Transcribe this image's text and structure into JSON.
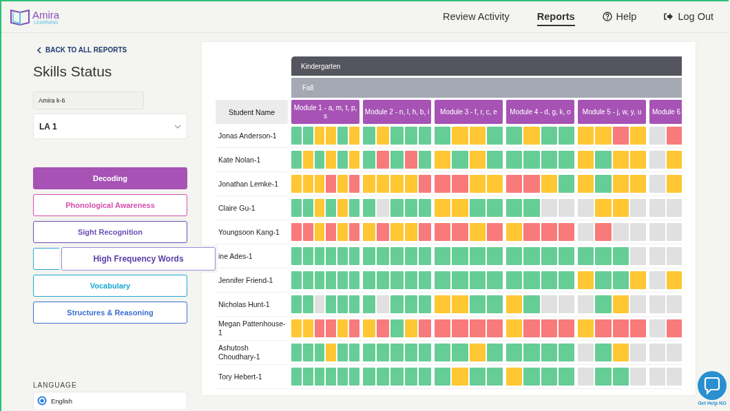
{
  "header": {
    "logo": {
      "name": "Amira",
      "sub": "LEARNING"
    },
    "nav": [
      {
        "label": "Review Activity",
        "kind": "text",
        "selected": false
      },
      {
        "label": "Reports",
        "kind": "text",
        "selected": true
      },
      {
        "label": "Help",
        "kind": "help",
        "selected": false
      },
      {
        "label": "Log Out",
        "kind": "logout",
        "selected": false
      }
    ]
  },
  "sidebar": {
    "back_link": "BACK TO ALL REPORTS",
    "title": "Skills Status",
    "program_field": "Amira k-6",
    "class_select": "LA 1",
    "skills": [
      {
        "label": "Decoding",
        "color": "#a653b5",
        "selected": true
      },
      {
        "label": "Phonological Awareness",
        "color": "#d64fae",
        "selected": false
      },
      {
        "label": "Sight Recognition",
        "color": "#6a4fb5",
        "selected": false
      },
      {
        "color": "#2aa9d6",
        "selected": false
      },
      {
        "label": "Vocabulary",
        "color": "#1aa8d0",
        "selected": false
      },
      {
        "label": "Structures & Reasoning",
        "color": "#3c6fd0",
        "selected": false
      }
    ],
    "popover": "High Frequency Words",
    "language": {
      "heading": "LANGUAGE",
      "options": [
        {
          "label": "English",
          "selected": true
        }
      ]
    }
  },
  "grid": {
    "grade": "Kindergarten",
    "season": "Fall",
    "name_heading": "Student Name",
    "modules": [
      {
        "label": "Module 1 - a, m, t, p, s"
      },
      {
        "label": "Module 2 - n, l, h, b, i"
      },
      {
        "label": "Module 3 - f, r, c, e"
      },
      {
        "label": "Module 4 - d, g, k, o"
      },
      {
        "label": "Module 5 - j, w, y, u"
      },
      {
        "label": "Module 6"
      }
    ],
    "students": [
      {
        "name": "Jonas Anderson-1",
        "modules": [
          [
            {
              "color": "#66cd96"
            },
            {
              "color": "#66cd96"
            },
            {
              "color": "#ffc733"
            },
            {
              "color": "#ffc733"
            },
            {
              "color": "#66cd96"
            },
            {
              "color": "#ffc733"
            }
          ],
          [
            {
              "color": "#66cd96"
            },
            {
              "color": "#ffc733"
            },
            {
              "color": "#66cd96"
            },
            {
              "color": "#66cd96"
            },
            {
              "color": "#66cd96"
            }
          ],
          [
            {
              "color": "#66cd96"
            },
            {
              "color": "#ffc733"
            },
            {
              "color": "#ffc733"
            },
            {
              "color": "#66cd96"
            }
          ],
          [
            {
              "color": "#66cd96"
            },
            {
              "color": "#ffc733"
            },
            {
              "color": "#66cd96"
            },
            {
              "color": "#66cd96"
            }
          ],
          [
            {
              "color": "#ffc733"
            },
            {
              "color": "#ffc733"
            },
            {
              "color": "#f87a7a"
            },
            {
              "color": "#ffc733"
            }
          ],
          [
            {
              "color": "#e0e0e0"
            },
            {
              "color": "#f87a7a"
            }
          ]
        ]
      },
      {
        "name": "Kate Nolan-1",
        "modules": [
          [
            {
              "color": "#66cd96"
            },
            {
              "color": "#ffc733"
            },
            {
              "color": "#66cd96"
            },
            {
              "color": "#ffc733"
            },
            {
              "color": "#66cd96"
            },
            {
              "color": "#ffc733"
            }
          ],
          [
            {
              "color": "#66cd96"
            },
            {
              "color": "#f87a7a"
            },
            {
              "color": "#66cd96"
            },
            {
              "color": "#f87a7a"
            },
            {
              "color": "#66cd96"
            }
          ],
          [
            {
              "color": "#ffc733"
            },
            {
              "color": "#66cd96"
            },
            {
              "color": "#ffc733"
            },
            {
              "color": "#66cd96"
            }
          ],
          [
            {
              "color": "#66cd96"
            },
            {
              "color": "#66cd96"
            },
            {
              "color": "#66cd96"
            },
            {
              "color": "#66cd96"
            }
          ],
          [
            {
              "color": "#ffc733"
            },
            {
              "color": "#66cd96"
            },
            {
              "color": "#ffc733"
            },
            {
              "color": "#ffc733"
            }
          ],
          [
            {
              "color": "#e0e0e0"
            },
            {
              "color": "#ffc733"
            }
          ]
        ]
      },
      {
        "name": "Jonathan Lemke-1",
        "modules": [
          [
            {
              "color": "#ffc733"
            },
            {
              "color": "#ffc733"
            },
            {
              "color": "#ffc733"
            },
            {
              "color": "#f87a7a"
            },
            {
              "color": "#ffc733"
            },
            {
              "color": "#f87a7a"
            }
          ],
          [
            {
              "color": "#ffc733"
            },
            {
              "color": "#ffc733"
            },
            {
              "color": "#ffc733"
            },
            {
              "color": "#ffc733"
            },
            {
              "color": "#f87a7a"
            }
          ],
          [
            {
              "color": "#f87a7a"
            },
            {
              "color": "#f87a7a"
            },
            {
              "color": "#ffc733"
            },
            {
              "color": "#ffc733"
            }
          ],
          [
            {
              "color": "#f87a7a"
            },
            {
              "color": "#f87a7a"
            },
            {
              "color": "#ffc733"
            },
            {
              "color": "#66cd96"
            }
          ],
          [
            {
              "color": "#ffc733"
            },
            {
              "color": "#66cd96"
            },
            {
              "color": "#ffc733"
            },
            {
              "color": "#ffc733"
            }
          ],
          [
            {
              "color": "#e0e0e0"
            },
            {
              "color": "#ffc733"
            }
          ]
        ]
      },
      {
        "name": "Claire Gu-1",
        "modules": [
          [
            {
              "color": "#66cd96"
            },
            {
              "color": "#66cd96"
            },
            {
              "color": "#ffc733"
            },
            {
              "color": "#66cd96"
            },
            {
              "color": "#ffc733"
            },
            {
              "color": "#66cd96"
            }
          ],
          [
            {
              "color": "#66cd96"
            },
            {
              "color": "#e0e0e0"
            },
            {
              "color": "#66cd96"
            },
            {
              "color": "#66cd96"
            },
            {
              "color": "#66cd96"
            }
          ],
          [
            {
              "color": "#ffc733"
            },
            {
              "color": "#ffc733"
            },
            {
              "color": "#66cd96"
            },
            {
              "color": "#66cd96"
            }
          ],
          [
            {
              "color": "#66cd96"
            },
            {
              "color": "#66cd96"
            },
            {
              "color": "#e0e0e0"
            },
            {
              "color": "#e0e0e0"
            }
          ],
          [
            {
              "color": "#e0e0e0"
            },
            {
              "color": "#ffc733"
            },
            {
              "color": "#ffc733"
            },
            {
              "color": "#e0e0e0"
            }
          ],
          [
            {
              "color": "#e0e0e0"
            },
            {
              "color": "#e0e0e0"
            }
          ]
        ]
      },
      {
        "name": "Youngsoon Kang-1",
        "modules": [
          [
            {
              "color": "#f87a7a"
            },
            {
              "color": "#f87a7a"
            },
            {
              "color": "#ffc733"
            },
            {
              "color": "#f87a7a"
            },
            {
              "color": "#ffc733"
            },
            {
              "color": "#f87a7a"
            }
          ],
          [
            {
              "color": "#ffc733"
            },
            {
              "color": "#f87a7a"
            },
            {
              "color": "#ffc733"
            },
            {
              "color": "#ffc733"
            },
            {
              "color": "#f87a7a"
            }
          ],
          [
            {
              "color": "#f87a7a"
            },
            {
              "color": "#f87a7a"
            },
            {
              "color": "#ffc733"
            },
            {
              "color": "#f87a7a"
            }
          ],
          [
            {
              "color": "#ffc733"
            },
            {
              "color": "#f87a7a"
            },
            {
              "color": "#f87a7a"
            },
            {
              "color": "#f87a7a"
            }
          ],
          [
            {
              "color": "#e0e0e0"
            },
            {
              "color": "#f87a7a"
            },
            {
              "color": "#e0e0e0"
            },
            {
              "color": "#e0e0e0"
            }
          ],
          [
            {
              "color": "#e0e0e0"
            },
            {
              "color": "#e0e0e0"
            }
          ]
        ]
      },
      {
        "name": "ine Ades-1",
        "modules": [
          [
            {
              "color": "#66cd96"
            },
            {
              "color": "#66cd96"
            },
            {
              "color": "#66cd96"
            },
            {
              "color": "#66cd96"
            },
            {
              "color": "#66cd96"
            },
            {
              "color": "#66cd96"
            }
          ],
          [
            {
              "color": "#66cd96"
            },
            {
              "color": "#66cd96"
            },
            {
              "color": "#66cd96"
            },
            {
              "color": "#66cd96"
            },
            {
              "color": "#66cd96"
            }
          ],
          [
            {
              "color": "#66cd96"
            },
            {
              "color": "#66cd96"
            },
            {
              "color": "#66cd96"
            },
            {
              "color": "#66cd96"
            }
          ],
          [
            {
              "color": "#66cd96"
            },
            {
              "color": "#66cd96"
            },
            {
              "color": "#66cd96"
            },
            {
              "color": "#66cd96"
            }
          ],
          [
            {
              "color": "#66cd96"
            },
            {
              "color": "#66cd96"
            },
            {
              "color": "#66cd96"
            },
            {
              "color": "#e0e0e0"
            }
          ],
          [
            {
              "color": "#e0e0e0"
            },
            {
              "color": "#e0e0e0"
            }
          ]
        ]
      },
      {
        "name": "Jennifer Friend-1",
        "modules": [
          [
            {
              "color": "#66cd96"
            },
            {
              "color": "#66cd96"
            },
            {
              "color": "#66cd96"
            },
            {
              "color": "#66cd96"
            },
            {
              "color": "#66cd96"
            },
            {
              "color": "#66cd96"
            }
          ],
          [
            {
              "color": "#66cd96"
            },
            {
              "color": "#66cd96"
            },
            {
              "color": "#66cd96"
            },
            {
              "color": "#66cd96"
            },
            {
              "color": "#66cd96"
            }
          ],
          [
            {
              "color": "#66cd96"
            },
            {
              "color": "#66cd96"
            },
            {
              "color": "#66cd96"
            },
            {
              "color": "#66cd96"
            }
          ],
          [
            {
              "color": "#66cd96"
            },
            {
              "color": "#66cd96"
            },
            {
              "color": "#66cd96"
            },
            {
              "color": "#66cd96"
            }
          ],
          [
            {
              "color": "#ffc733"
            },
            {
              "color": "#66cd96"
            },
            {
              "color": "#66cd96"
            },
            {
              "color": "#ffc733"
            }
          ],
          [
            {
              "color": "#e0e0e0"
            },
            {
              "color": "#ffc733"
            }
          ]
        ]
      },
      {
        "name": "Nicholas Hunt-1",
        "modules": [
          [
            {
              "color": "#66cd96"
            },
            {
              "color": "#66cd96"
            },
            {
              "color": "#e0e0e0"
            },
            {
              "color": "#66cd96"
            },
            {
              "color": "#66cd96"
            },
            {
              "color": "#66cd96"
            }
          ],
          [
            {
              "color": "#66cd96"
            },
            {
              "color": "#e0e0e0"
            },
            {
              "color": "#66cd96"
            },
            {
              "color": "#66cd96"
            },
            {
              "color": "#66cd96"
            }
          ],
          [
            {
              "color": "#ffc733"
            },
            {
              "color": "#ffc733"
            },
            {
              "color": "#66cd96"
            },
            {
              "color": "#66cd96"
            }
          ],
          [
            {
              "color": "#ffc733"
            },
            {
              "color": "#66cd96"
            },
            {
              "color": "#e0e0e0"
            },
            {
              "color": "#e0e0e0"
            }
          ],
          [
            {
              "color": "#e0e0e0"
            },
            {
              "color": "#66cd96"
            },
            {
              "color": "#ffc733"
            },
            {
              "color": "#e0e0e0"
            }
          ],
          [
            {
              "color": "#e0e0e0"
            },
            {
              "color": "#e0e0e0"
            }
          ]
        ]
      },
      {
        "name": "Megan Pattenhouse-1",
        "modules": [
          [
            {
              "color": "#ffc733"
            },
            {
              "color": "#ffc733"
            },
            {
              "color": "#f87a7a"
            },
            {
              "color": "#f87a7a"
            },
            {
              "color": "#ffc733"
            },
            {
              "color": "#f87a7a"
            }
          ],
          [
            {
              "color": "#ffc733"
            },
            {
              "color": "#f87a7a"
            },
            {
              "color": "#66cd96"
            },
            {
              "color": "#ffc733"
            },
            {
              "color": "#f87a7a"
            }
          ],
          [
            {
              "color": "#f87a7a"
            },
            {
              "color": "#f87a7a"
            },
            {
              "color": "#f87a7a"
            },
            {
              "color": "#f87a7a"
            }
          ],
          [
            {
              "color": "#ffc733"
            },
            {
              "color": "#f87a7a"
            },
            {
              "color": "#f87a7a"
            },
            {
              "color": "#f87a7a"
            }
          ],
          [
            {
              "color": "#ffc733"
            },
            {
              "color": "#f87a7a"
            },
            {
              "color": "#f87a7a"
            },
            {
              "color": "#f87a7a"
            }
          ],
          [
            {
              "color": "#e0e0e0"
            },
            {
              "color": "#f87a7a"
            }
          ]
        ]
      },
      {
        "name": "Ashutosh Choudhary-1",
        "modules": [
          [
            {
              "color": "#66cd96"
            },
            {
              "color": "#66cd96"
            },
            {
              "color": "#66cd96"
            },
            {
              "color": "#ffc733"
            },
            {
              "color": "#66cd96"
            },
            {
              "color": "#66cd96"
            }
          ],
          [
            {
              "color": "#66cd96"
            },
            {
              "color": "#66cd96"
            },
            {
              "color": "#66cd96"
            },
            {
              "color": "#66cd96"
            },
            {
              "color": "#66cd96"
            }
          ],
          [
            {
              "color": "#66cd96"
            },
            {
              "color": "#66cd96"
            },
            {
              "color": "#ffc733"
            },
            {
              "color": "#66cd96"
            }
          ],
          [
            {
              "color": "#66cd96"
            },
            {
              "color": "#66cd96"
            },
            {
              "color": "#66cd96"
            },
            {
              "color": "#66cd96"
            }
          ],
          [
            {
              "color": "#e0e0e0"
            },
            {
              "color": "#66cd96"
            },
            {
              "color": "#ffc733"
            },
            {
              "color": "#e0e0e0"
            }
          ],
          [
            {
              "color": "#e0e0e0"
            },
            {
              "color": "#e0e0e0"
            }
          ]
        ]
      },
      {
        "name": "Tory Hebert-1",
        "modules": [
          [
            {
              "color": "#66cd96"
            },
            {
              "color": "#66cd96"
            },
            {
              "color": "#66cd96"
            },
            {
              "color": "#66cd96"
            },
            {
              "color": "#66cd96"
            },
            {
              "color": "#66cd96"
            }
          ],
          [
            {
              "color": "#66cd96"
            },
            {
              "color": "#66cd96"
            },
            {
              "color": "#66cd96"
            },
            {
              "color": "#66cd96"
            },
            {
              "color": "#66cd96"
            }
          ],
          [
            {
              "color": "#66cd96"
            },
            {
              "color": "#ffc733"
            },
            {
              "color": "#66cd96"
            },
            {
              "color": "#66cd96"
            }
          ],
          [
            {
              "color": "#ffc733"
            },
            {
              "color": "#66cd96"
            },
            {
              "color": "#66cd96"
            },
            {
              "color": "#66cd96"
            }
          ],
          [
            {
              "color": "#e0e0e0"
            },
            {
              "color": "#66cd96"
            },
            {
              "color": "#66cd96"
            },
            {
              "color": "#e0e0e0"
            }
          ],
          [
            {
              "color": "#e0e0e0"
            },
            {
              "color": "#e0e0e0"
            }
          ]
        ]
      }
    ]
  },
  "help_widget": {
    "label": "Get Help NO"
  }
}
